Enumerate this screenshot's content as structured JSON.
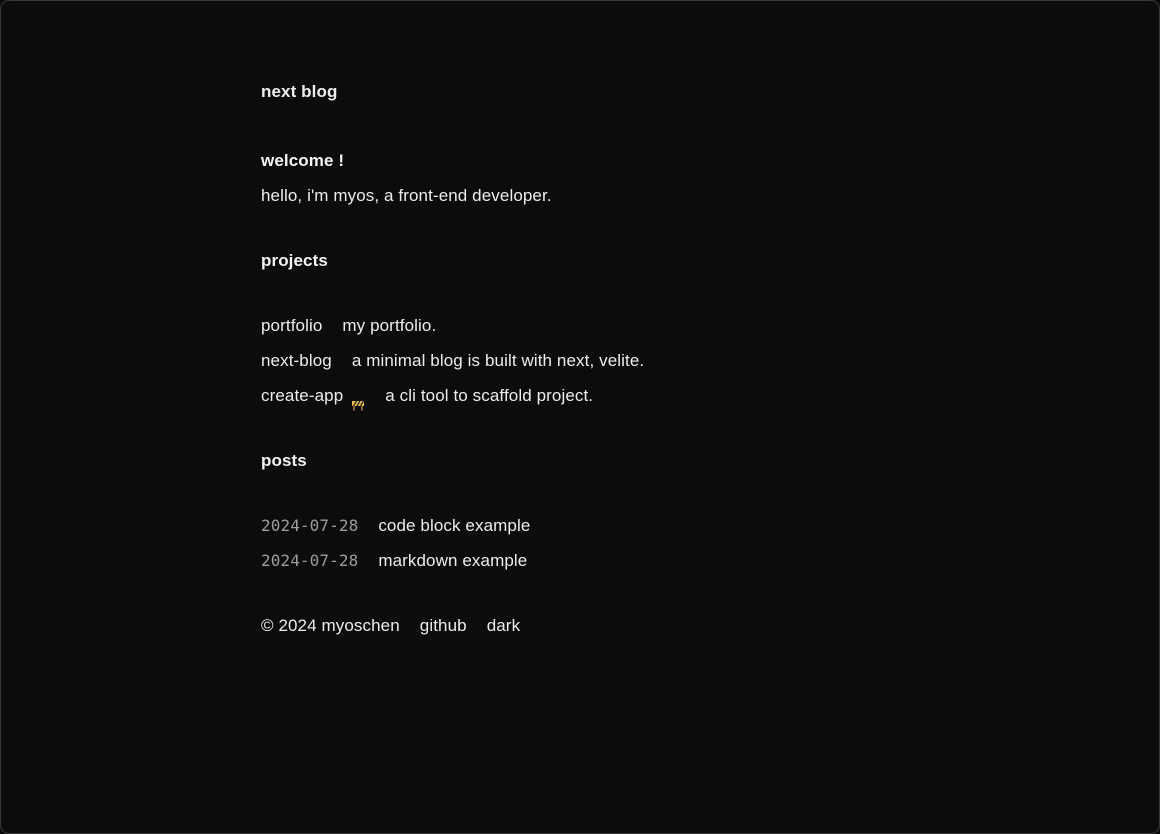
{
  "header": {
    "site_title": "next blog"
  },
  "welcome": {
    "heading": "welcome !",
    "intro": "hello, i'm myos, a front-end developer."
  },
  "projects": {
    "heading": "projects",
    "items": [
      {
        "name": "portfolio",
        "description": "my portfolio.",
        "icon": null
      },
      {
        "name": "next-blog",
        "description": "a minimal blog is built with next, velite.",
        "icon": null
      },
      {
        "name": "create-app",
        "description": "a cli tool to scaffold project.",
        "icon": "construction-barrier-icon"
      }
    ]
  },
  "posts": {
    "heading": "posts",
    "items": [
      {
        "date": "2024-07-28",
        "title": "code block example"
      },
      {
        "date": "2024-07-28",
        "title": "markdown example"
      }
    ]
  },
  "footer": {
    "copyright": "© 2024 myoschen",
    "github_label": "github",
    "theme_label": "dark"
  },
  "colors": {
    "background": "#0c0c0c",
    "text": "#ededed",
    "muted": "#9c9c9c"
  }
}
